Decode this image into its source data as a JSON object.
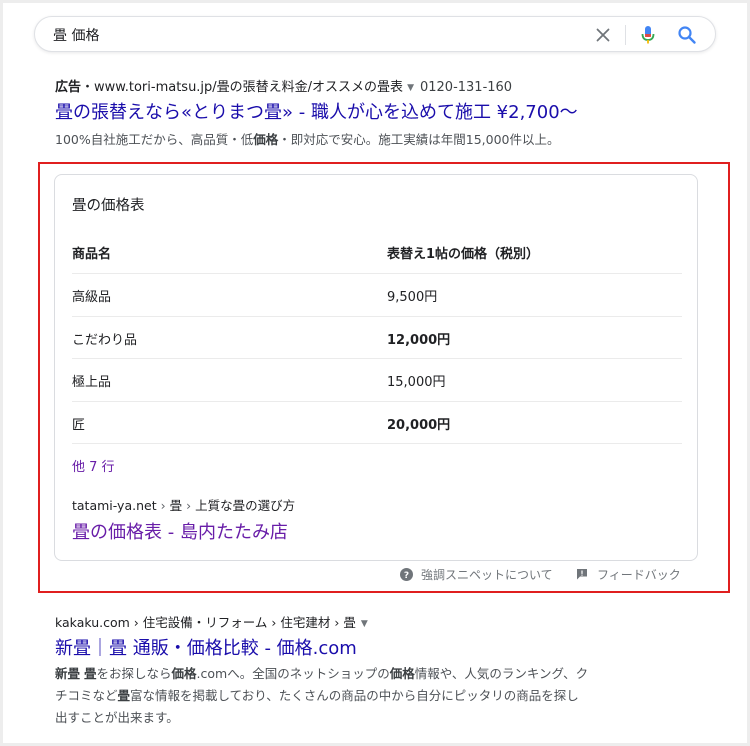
{
  "search": {
    "query": "畳 価格"
  },
  "ad": {
    "label": "広告",
    "dot": "・",
    "url": "www.tori-matsu.jp/畳の張替え料金/オススメの畳表",
    "caret": "▼",
    "phone": "0120-131-160",
    "title": "畳の張替えなら«とりまつ畳» - 職人が心を込めて施工 ¥2,700〜",
    "desc_1": "100%自社施工だから、高品質・低",
    "desc_bold": "価格",
    "desc_2": "・即対応で安心。施工実績は年間15,000件以上。"
  },
  "snippet": {
    "title": "畳の価格表",
    "headers": [
      "商品名",
      "表替え1帖の価格（税別）"
    ],
    "rows": [
      {
        "name": "高級品",
        "price": "9,500円"
      },
      {
        "name": "こだわり品",
        "price": "12,000円"
      },
      {
        "name": "極上品",
        "price": "15,000円"
      },
      {
        "name": "匠",
        "price": "20,000円"
      }
    ],
    "more": "他 7 行",
    "cite_domain": "tatami-ya.net",
    "cite_sep": "›",
    "cite_path_1": "畳",
    "cite_path_2": "上質な畳の選び方",
    "link_title": "畳の価格表 - 島内たたみ店",
    "about": "強調スニペットについて",
    "feedback": "フィードバック"
  },
  "organic": {
    "cite_domain": "kakaku.com",
    "cite_sep": "›",
    "cite_path_1": "住宅設備・リフォーム",
    "cite_path_2": "住宅建材",
    "cite_path_3": "畳",
    "caret": "▼",
    "title": "新畳｜畳 通販・価格比較 - 価格.com",
    "desc_p1": "新畳",
    "desc_p2": " ",
    "desc_p3": "畳",
    "desc_p4": "をお探しなら",
    "desc_p5": "価格",
    "desc_p6": ".comへ。全国のネットショップの",
    "desc_p7": "価格",
    "desc_p8": "情報や、人気のランキング、ク",
    "desc_line2_a": "チコミなど",
    "desc_line2_b": "畳",
    "desc_line2_c": "富な情報を掲載しており、たくさんの商品の中から自分にピッタリの商品を探し",
    "desc_line3": "出すことが出来ます。"
  },
  "colors": {
    "link": "#1a0dab",
    "visited": "#681da8",
    "highlight": "#e01f1f",
    "mic_blue": "#4285f4",
    "mic_red": "#ea4335"
  }
}
